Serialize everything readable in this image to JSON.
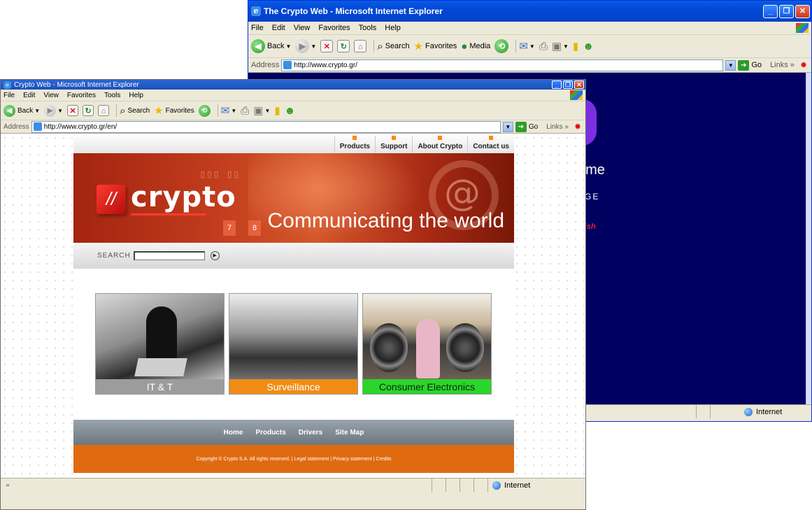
{
  "back_window": {
    "title": "The Crypto Web - Microsoft Internet Explorer",
    "menu": [
      "File",
      "Edit",
      "View",
      "Favorites",
      "Tools",
      "Help"
    ],
    "toolbar": {
      "back": "Back",
      "search": "Search",
      "favorites": "Favorites",
      "media": "Media"
    },
    "address_label": "Address",
    "address": "http://www.crypto.gr/",
    "go": "Go",
    "links": "Links",
    "content": {
      "background": "#000060",
      "partial_texts": [
        "ome",
        "AGE",
        "glish"
      ]
    },
    "status_zone": "Internet"
  },
  "front_window": {
    "title": "Crypto Web - Microsoft Internet Explorer",
    "menu": [
      "File",
      "Edit",
      "View",
      "Favorites",
      "Tools",
      "Help"
    ],
    "toolbar": {
      "back": "Back",
      "search": "Search",
      "favorites": "Favorites"
    },
    "address_label": "Address",
    "address": "http://www.crypto.gr/en/",
    "go": "Go",
    "links": "Links",
    "status_zone": "Internet"
  },
  "site": {
    "top_nav": [
      "Products",
      "Support",
      "About Crypto",
      "Contact us"
    ],
    "logo": "crypto",
    "tagline": "Communicating the world",
    "banner_keys": [
      "7",
      "8"
    ],
    "search_label": "SEARCH",
    "tiles": [
      {
        "caption": "IT & T",
        "color": "#9c9c9c"
      },
      {
        "caption": "Surveillance",
        "color": "#f08c14"
      },
      {
        "caption": "Consumer Electronics",
        "color": "#2bd52b"
      }
    ],
    "footer_nav": [
      "Home",
      "Products",
      "Drivers",
      "Site Map"
    ],
    "copyright": "Copyright © Crypto S.A. All rights reserved.  |  Legal statement  |  Privacy statement  |  Credits"
  },
  "colors": {
    "titlebar_blue": "#0054e3",
    "accent_orange": "#e06a10",
    "banner_red": "#c03a1c"
  }
}
